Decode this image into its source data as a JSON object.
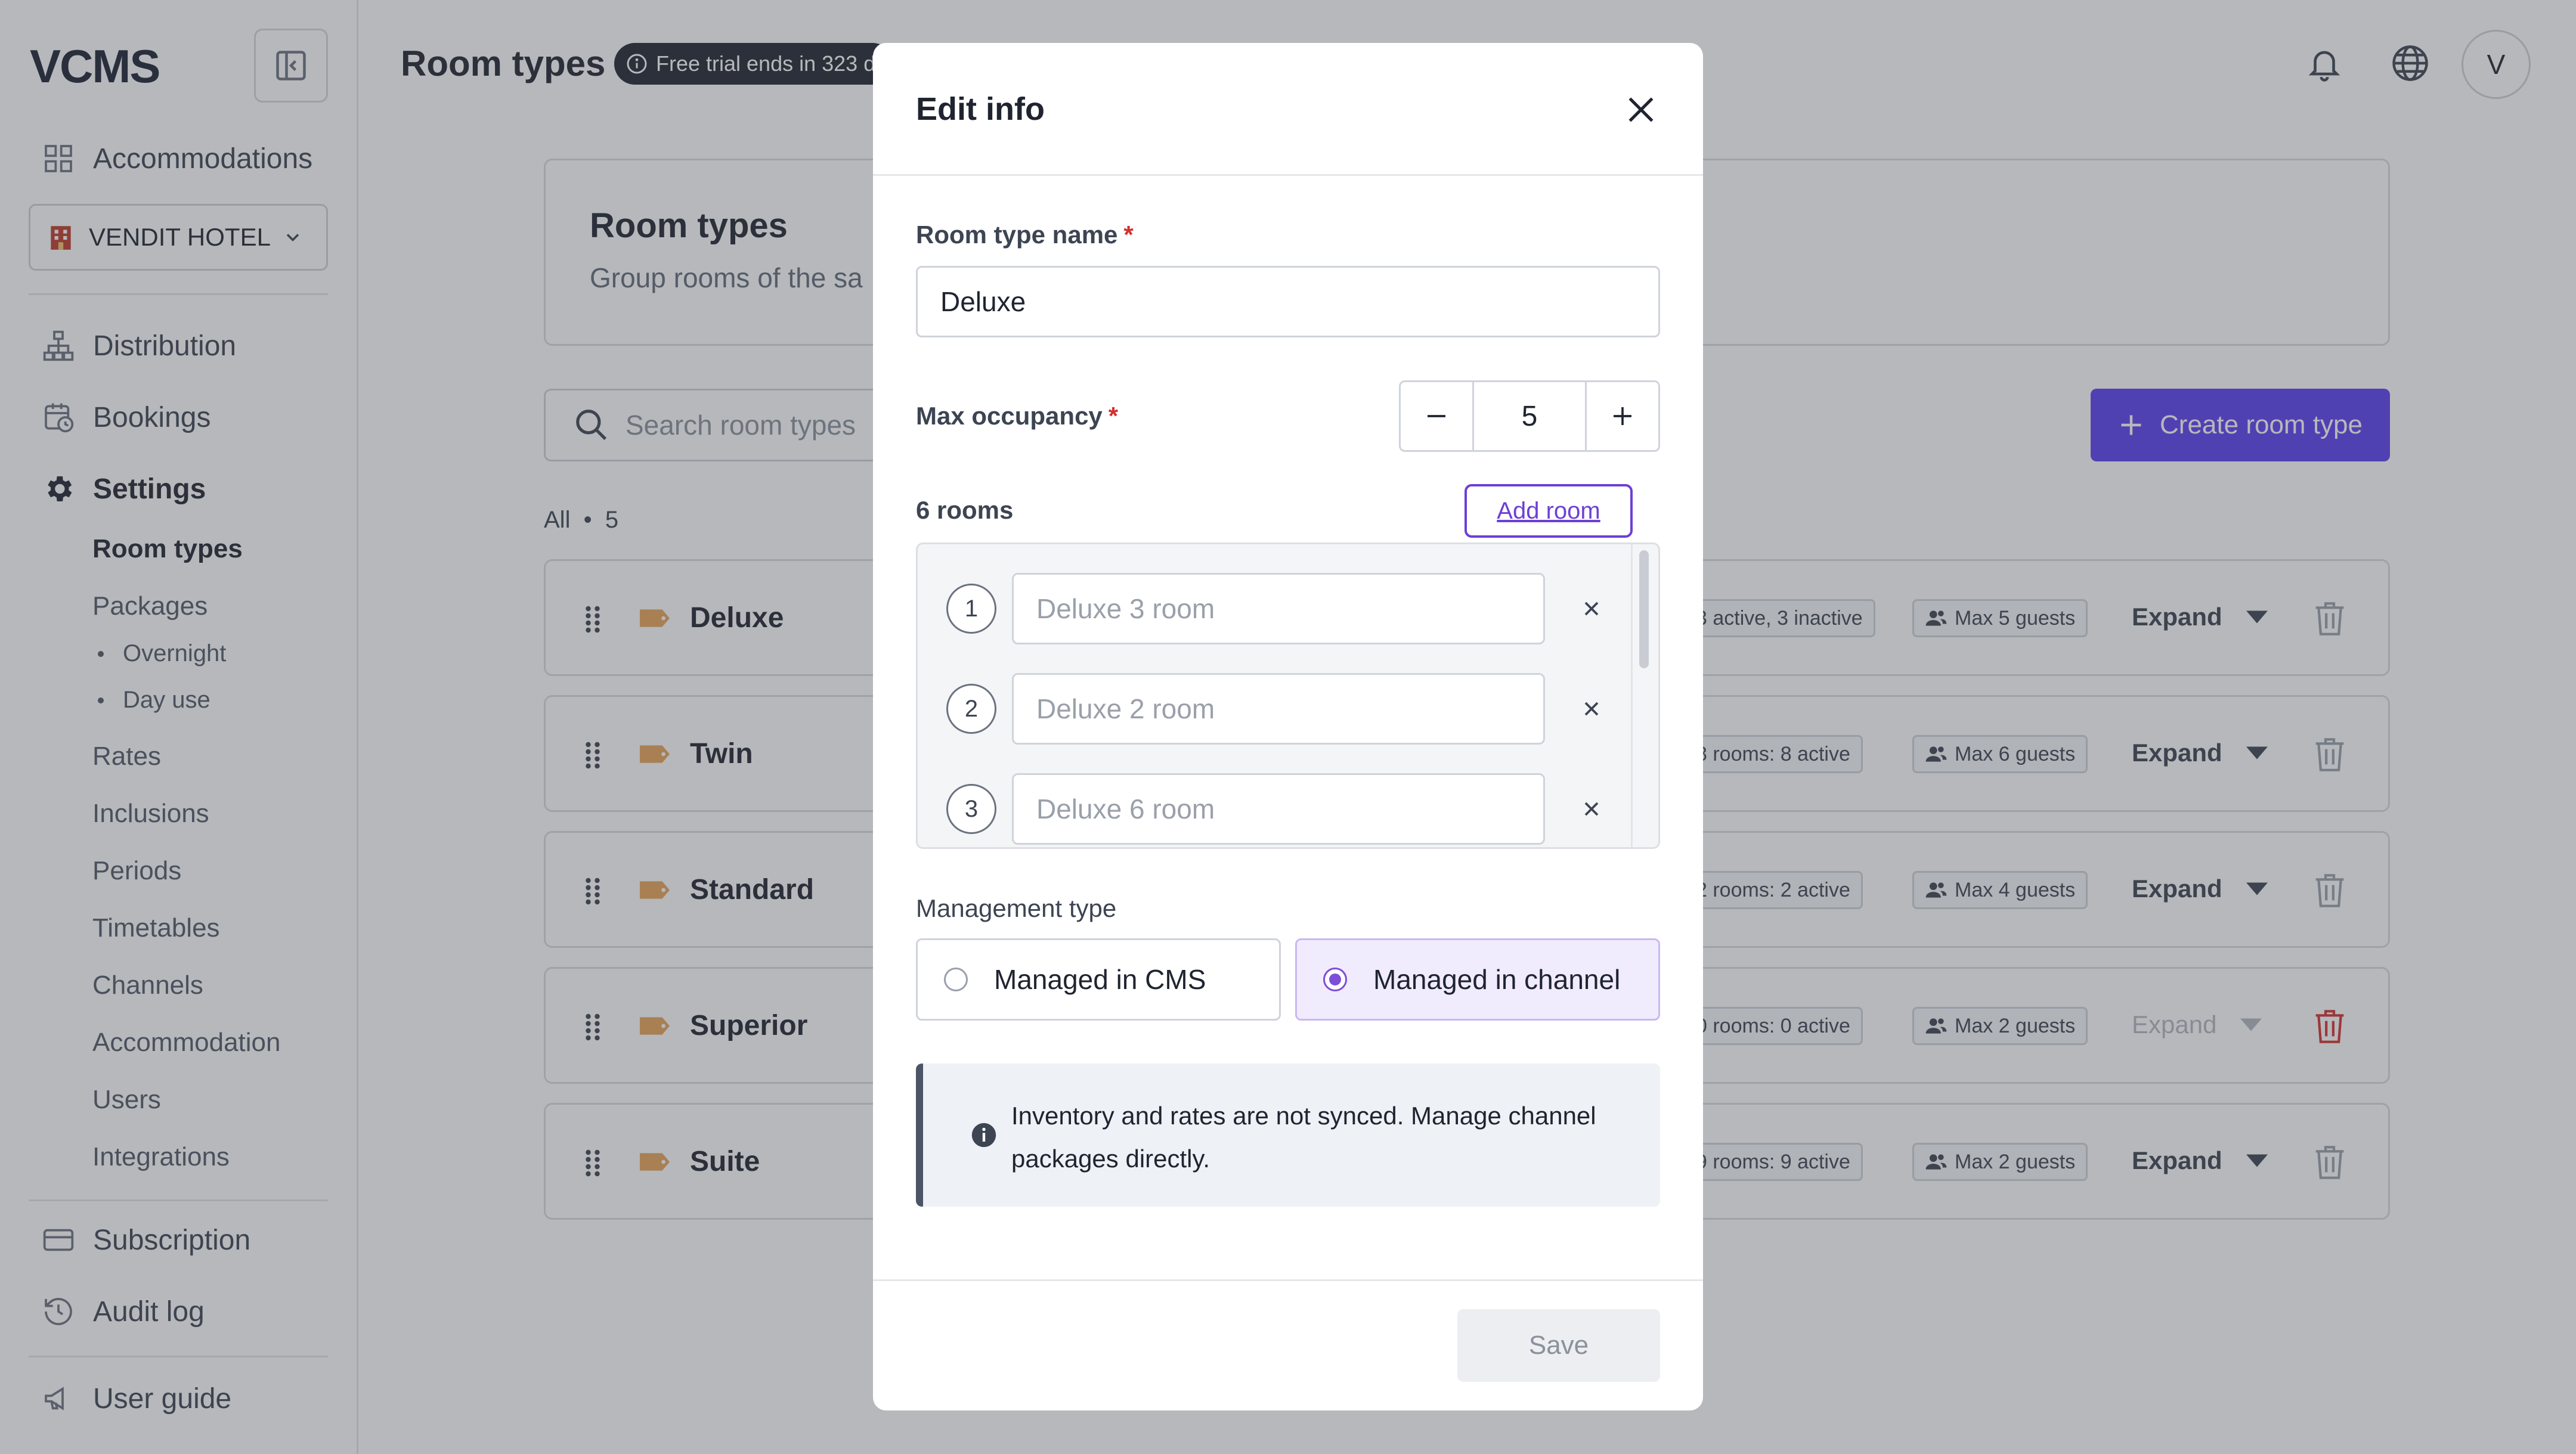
{
  "app": {
    "logo": "VCMS"
  },
  "sidebar": {
    "accommodations": "Accommodations",
    "hotel": "VENDIT HOTEL",
    "nav": [
      "Distribution",
      "Bookings",
      "Settings"
    ],
    "settings_items": [
      "Room types",
      "Packages"
    ],
    "package_items": [
      "Overnight",
      "Day use"
    ],
    "settings_more": [
      "Rates",
      "Inclusions",
      "Periods",
      "Timetables",
      "Channels",
      "Accommodation",
      "Users",
      "Integrations"
    ],
    "bottom": [
      "Subscription",
      "Audit log"
    ],
    "guide": "User guide"
  },
  "header": {
    "title": "Room types",
    "trial": "Free trial ends in 323 d",
    "avatar": "V"
  },
  "card": {
    "title": "Room types",
    "subtitle": "Group rooms of the sa"
  },
  "search": {
    "placeholder": "Search room types"
  },
  "create_button": "Create room type",
  "list": {
    "all_label": "All",
    "count": "5",
    "expand": "Expand"
  },
  "rooms": [
    {
      "name": "Deluxe",
      "status": "3 active, 3 inactive",
      "guests": "Max 5 guests",
      "expand_enabled": true
    },
    {
      "name": "Twin",
      "status": "8 rooms: 8 active",
      "guests": "Max 6 guests",
      "expand_enabled": true
    },
    {
      "name": "Standard",
      "status": "2 rooms: 2 active",
      "guests": "Max 4 guests",
      "expand_enabled": true
    },
    {
      "name": "Superior",
      "status": "0 rooms: 0 active",
      "guests": "Max 2 guests",
      "expand_enabled": false
    },
    {
      "name": "Suite",
      "status": "9 rooms: 9 active",
      "guests": "Max 2 guests",
      "expand_enabled": true
    }
  ],
  "modal": {
    "title": "Edit info",
    "name_label": "Room type name",
    "required_mark": "*",
    "name_value": "Deluxe",
    "occupancy_label": "Max occupancy",
    "occupancy_value": "5",
    "rooms_label": "6 rooms",
    "add_room": "Add room",
    "room_entries": [
      {
        "num": "1",
        "placeholder": "Deluxe 3 room"
      },
      {
        "num": "2",
        "placeholder": "Deluxe 2 room"
      },
      {
        "num": "3",
        "placeholder": "Deluxe 6 room"
      }
    ],
    "management_label": "Management type",
    "option_cms": "Managed in CMS",
    "option_channel": "Managed in channel",
    "selected_option": "channel",
    "alert": "Inventory and rates are not synced. Manage channel packages directly.",
    "save": "Save"
  },
  "colors": {
    "accent": "#5b3ff0",
    "danger": "#d32f2f",
    "selected": "#7c4ddb"
  }
}
